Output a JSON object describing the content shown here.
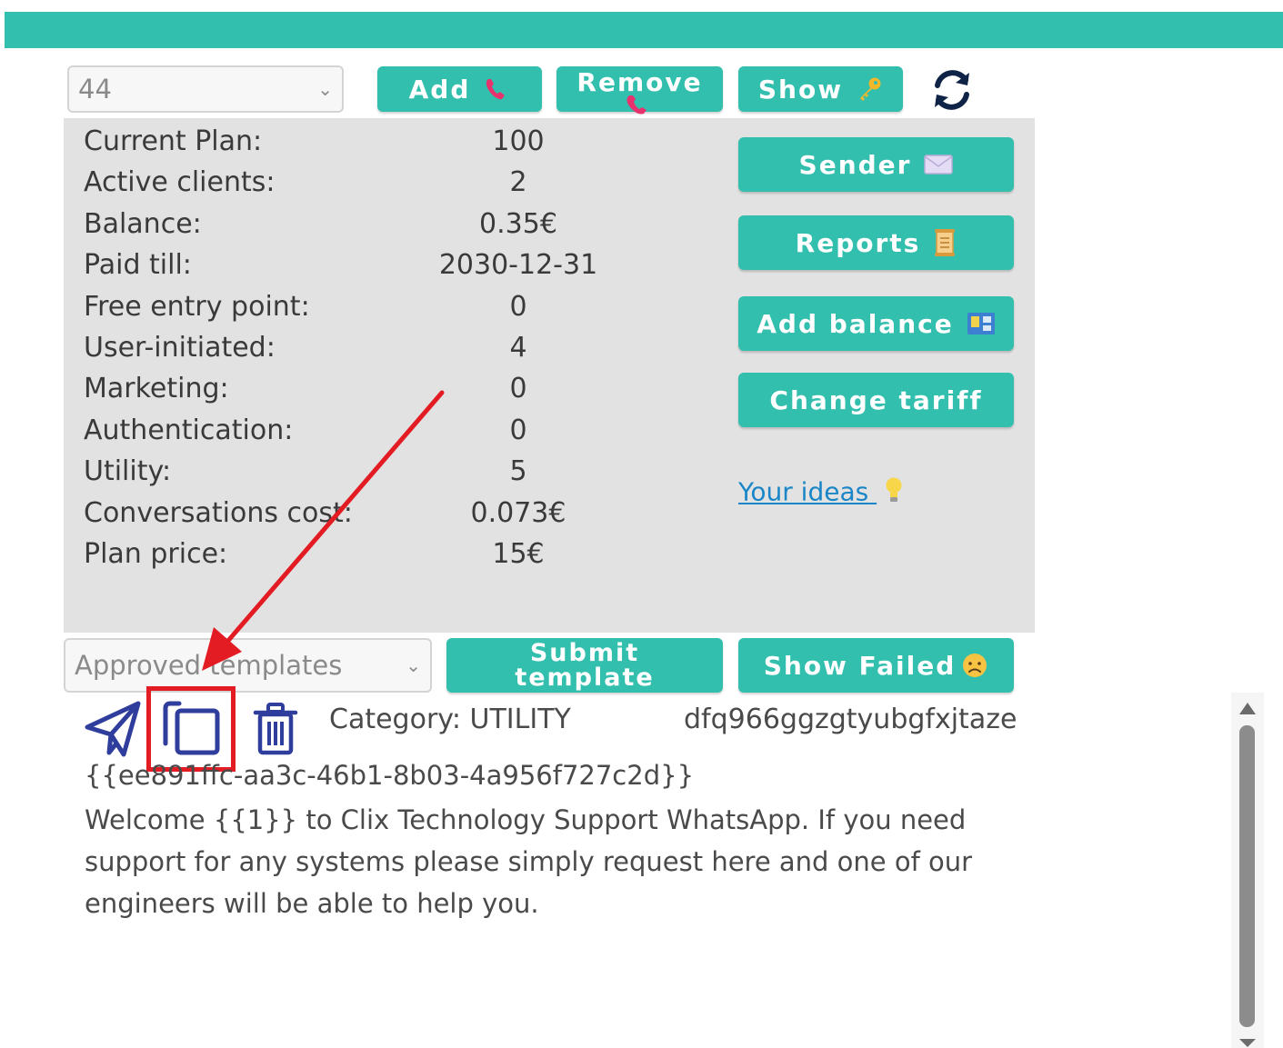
{
  "toolbar": {
    "number_select": {
      "value": "44",
      "caret": "⌄"
    },
    "add_label": "Add",
    "remove_label": "Remove",
    "show_label": "Show",
    "refresh_icon": "refresh-icon",
    "phone_icon": "phone-receiver-icon",
    "key_icon": "key-icon"
  },
  "stats": [
    {
      "label": "Current Plan:",
      "value": "100"
    },
    {
      "label": "Active clients:",
      "value": "2"
    },
    {
      "label": "Balance:",
      "value": "0.35€"
    },
    {
      "label": "Paid till:",
      "value": "2030-12-31"
    },
    {
      "label": "Free entry point:",
      "value": "0"
    },
    {
      "label": "User-initiated:",
      "value": "4"
    },
    {
      "label": "Marketing:",
      "value": "0"
    },
    {
      "label": "Authentication:",
      "value": "0"
    },
    {
      "label": "Utility:",
      "value": "5"
    },
    {
      "label": "Conversations cost:",
      "value": "0.073€"
    },
    {
      "label": "Plan price:",
      "value": "15€"
    }
  ],
  "side_actions": {
    "sender_label": "Sender",
    "reports_label": "Reports",
    "add_balance_label": "Add balance",
    "change_tariff_label": "Change tariff",
    "ideas_link": "Your ideas"
  },
  "templates": {
    "select_value": "Approved templates",
    "select_caret": "⌄",
    "submit_label": "Submit template",
    "show_failed_label": "Show Failed"
  },
  "template_item": {
    "category": "Category: UTILITY",
    "name": "dfq966ggzgtyubgfxjtaze",
    "id": "{{ee891ffc-aa3c-46b1-8b03-4a956f727c2d}}",
    "body": "Welcome {{1}} to Clix Technology Support WhatsApp. If you need support for any systems please simply request here and one of our engineers will be able to help you."
  },
  "colors": {
    "accent": "#32bfad",
    "panel": "#e2e2e2",
    "icon_blue": "#2f3d9c",
    "link": "#1a86c7",
    "annotation_red": "#e31b23"
  }
}
